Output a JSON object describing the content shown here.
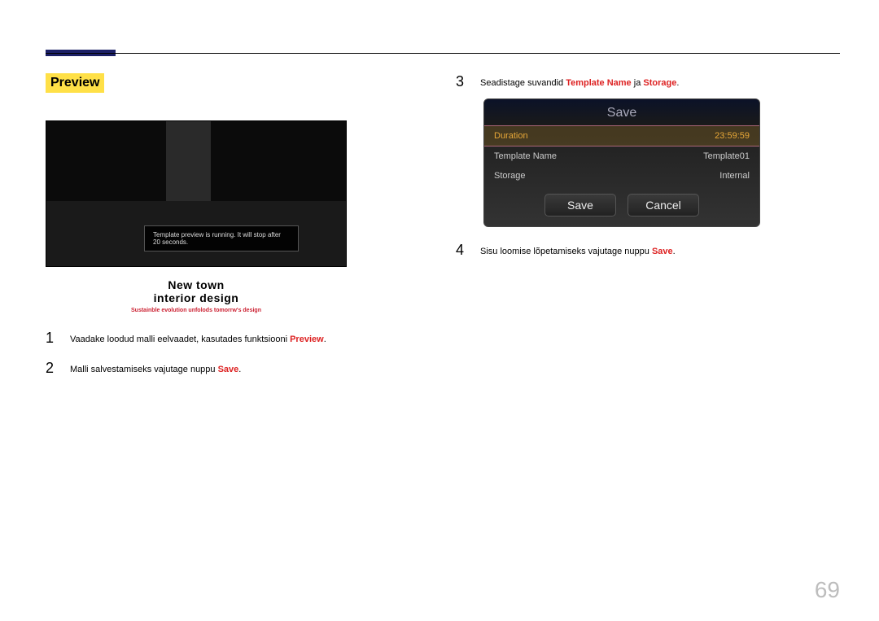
{
  "section_title": "Preview",
  "monitor_tooltip": "Template preview is running. It will stop after 20 seconds.",
  "preview_caption": {
    "line1": "New  town",
    "line2": "interior  design",
    "sub": "Sustainble evolution unfolods tomorrw's design"
  },
  "left_steps": [
    {
      "num": "1",
      "pre": "Vaadake loodud malli eelvaadet, kasutades funktsiooni ",
      "hl1": "Preview",
      "mid": "",
      "hl2": "",
      "post": "."
    },
    {
      "num": "2",
      "pre": "Malli salvestamiseks vajutage nuppu ",
      "hl1": "Save",
      "mid": "",
      "hl2": "",
      "post": "."
    }
  ],
  "right_steps": [
    {
      "num": "3",
      "pre": "Seadistage suvandid ",
      "hl1": "Template Name",
      "mid": " ja ",
      "hl2": "Storage",
      "post": "."
    },
    {
      "num": "4",
      "pre": "Sisu loomise lõpetamiseks vajutage nuppu ",
      "hl1": "Save",
      "mid": "",
      "hl2": "",
      "post": "."
    }
  ],
  "save_dialog": {
    "title": "Save",
    "rows": [
      {
        "k": "Duration",
        "v": "23:59:59",
        "selected": true
      },
      {
        "k": "Template Name",
        "v": "Template01",
        "selected": false
      },
      {
        "k": "Storage",
        "v": "Internal",
        "selected": false
      }
    ],
    "buttons": {
      "save": "Save",
      "cancel": "Cancel"
    }
  },
  "page_number": "69"
}
